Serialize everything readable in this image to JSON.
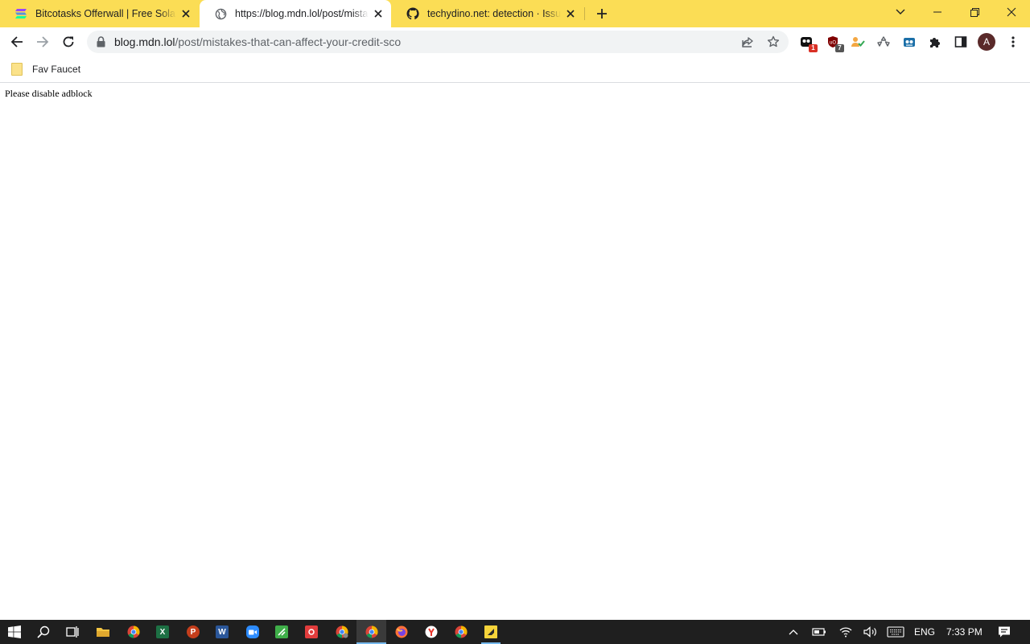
{
  "tabs": [
    {
      "title": "Bitcotasks Offerwall | Free Solana",
      "active": false
    },
    {
      "title": "https://blog.mdn.lol/post/mistakes-that-can-affect-your-credit-score",
      "active": true
    },
    {
      "title": "techydino.net: detection · Issue #",
      "active": false
    }
  ],
  "address_bar": {
    "host": "blog.mdn.lol",
    "path": "/post/mistakes-that-can-affect-your-credit-sco"
  },
  "extensions": {
    "badge_1": "1",
    "badge_2": "7"
  },
  "profile": {
    "initial": "A"
  },
  "bookmarks": [
    {
      "label": "Fav Faucet"
    }
  ],
  "page": {
    "message": "Please disable adblock"
  },
  "taskbar": {
    "language": "ENG",
    "time": "7:33 PM"
  },
  "colors": {
    "tabstrip": "#fbdd55",
    "taskbar": "#1f1f1f"
  }
}
